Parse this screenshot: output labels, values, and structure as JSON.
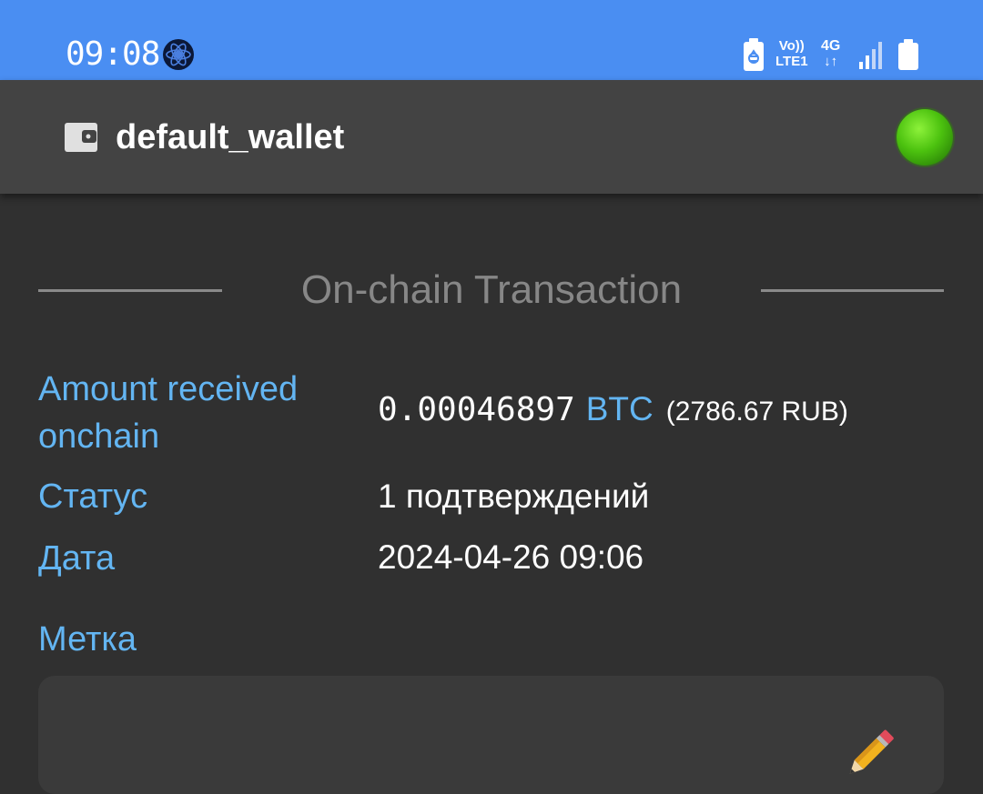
{
  "status_bar": {
    "time": "09:08",
    "volte_line1": "Vo))",
    "volte_line2": "LTE1",
    "network": "4G",
    "icons": [
      "electrum-app-icon",
      "battery-saver-icon",
      "signal-icon",
      "battery-icon"
    ]
  },
  "app_bar": {
    "wallet_name": "default_wallet",
    "wallet_icon": "wallet-icon",
    "connection_status_color": "#4cc20f"
  },
  "section": {
    "title": "On-chain Transaction"
  },
  "details": {
    "amount": {
      "label": "Amount received onchain",
      "value": "0.00046897",
      "unit": "BTC",
      "fiat": "(2786.67 RUB)"
    },
    "status": {
      "label": "Статус",
      "value": "1 подтверждений"
    },
    "date": {
      "label": "Дата",
      "value": "2024-04-26 09:06"
    },
    "tag": {
      "label": "Метка",
      "value": ""
    }
  },
  "colors": {
    "status_bar": "#4a8ef2",
    "app_bar": "#434343",
    "background": "#303030",
    "accent_label": "#63b5f2",
    "muted_title": "#878787"
  }
}
